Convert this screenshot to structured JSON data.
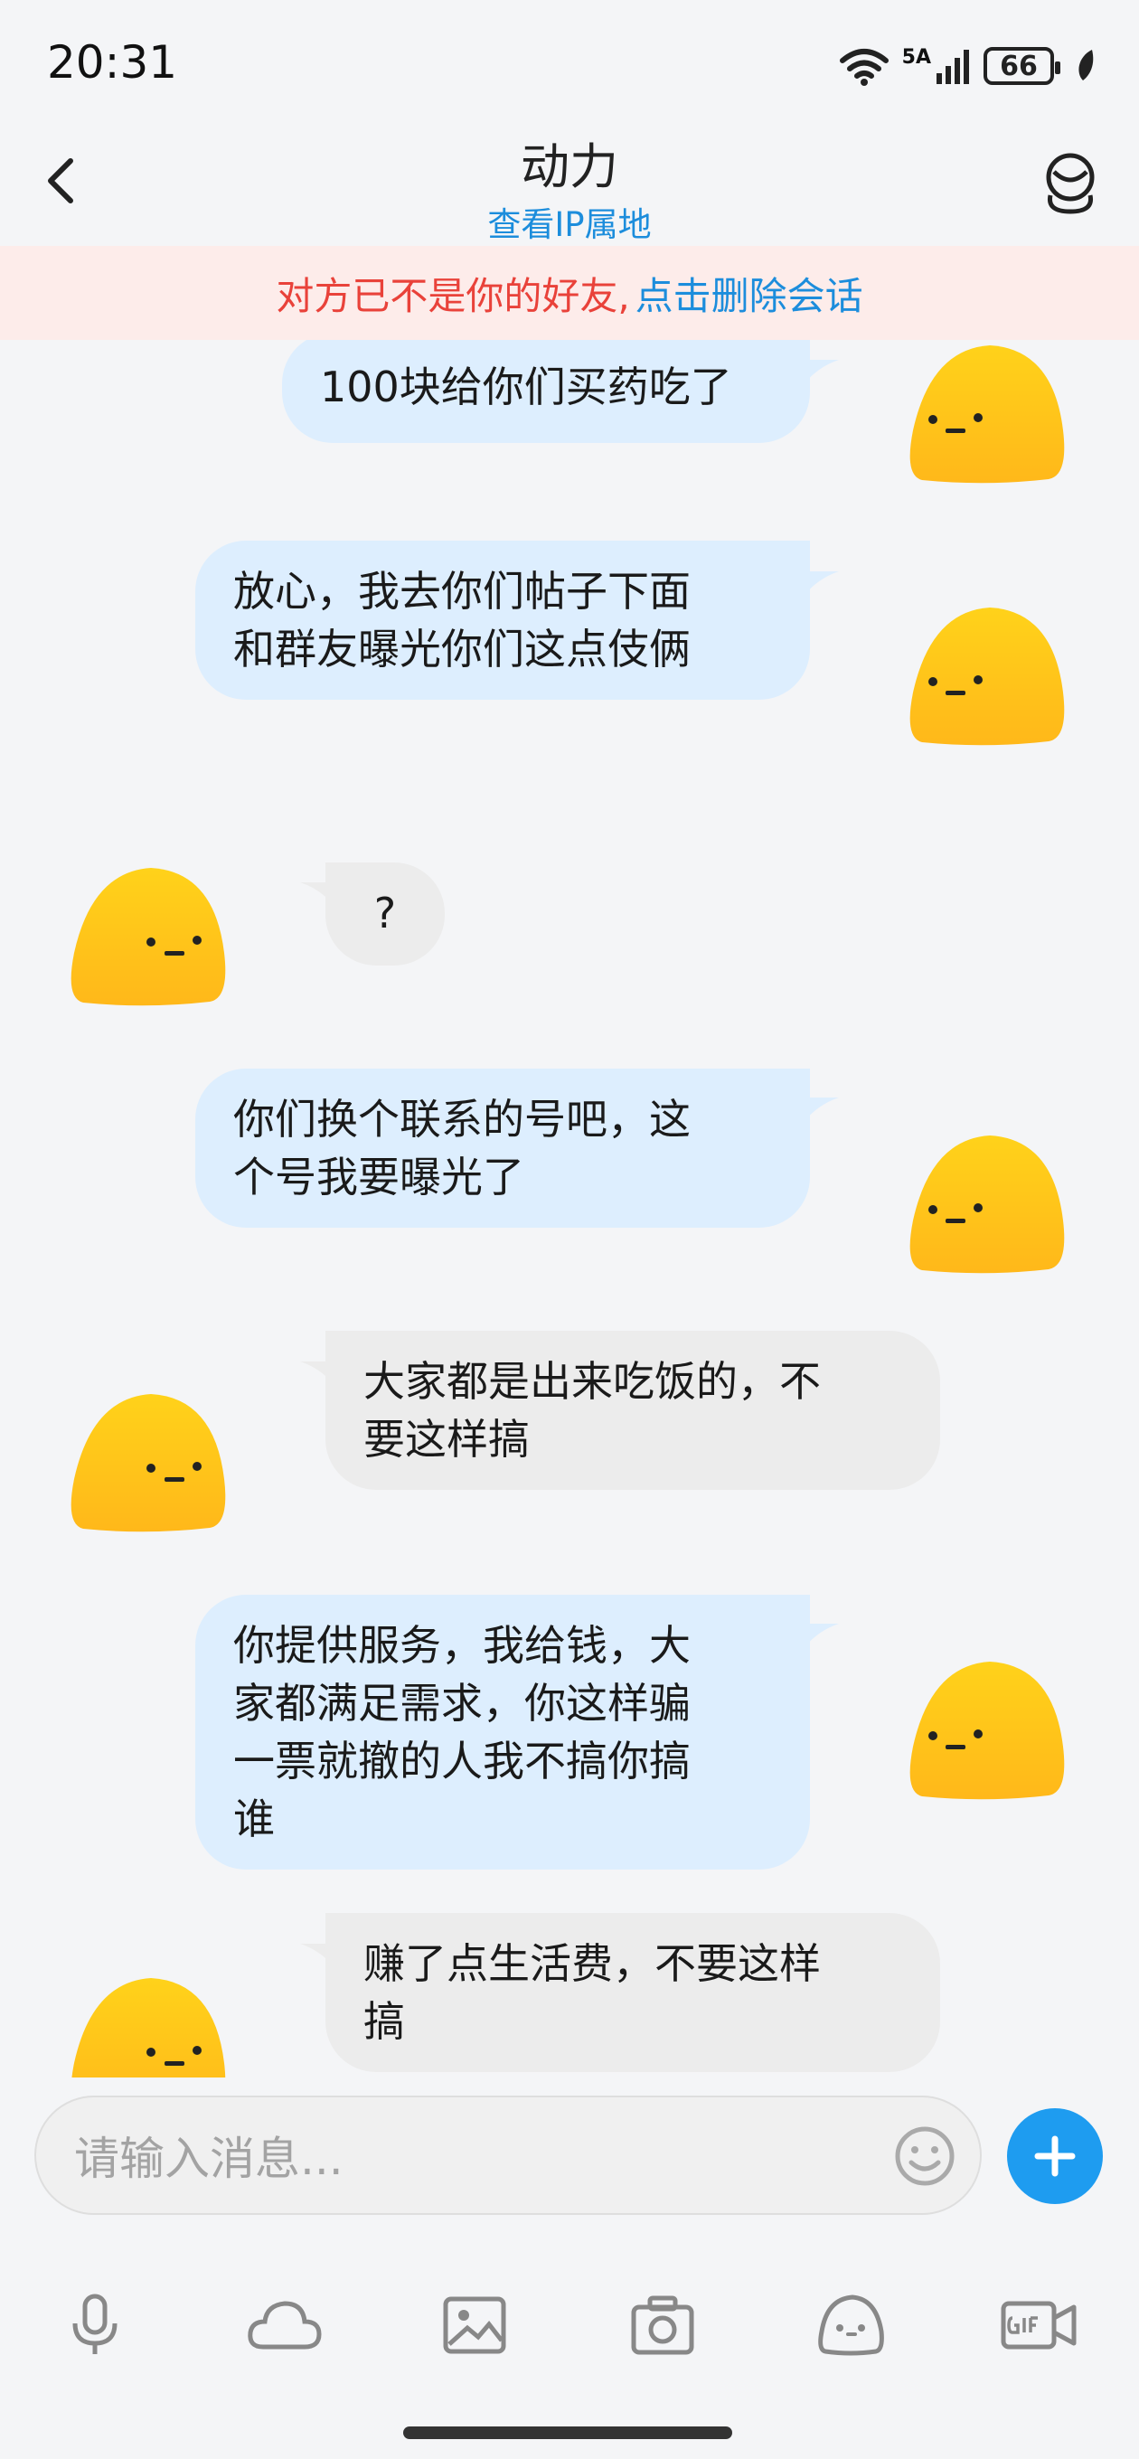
{
  "status_bar": {
    "time": "20:31",
    "network": "5A",
    "battery": "66"
  },
  "header": {
    "title": "动力",
    "subtitle_link": "查看IP属地"
  },
  "warning": {
    "text": "对方已不是你的好友,",
    "link": "点击删除会话"
  },
  "messages": [
    {
      "side": "out",
      "text": "100块给你们买药吃了"
    },
    {
      "side": "out",
      "text": "放心，我去你们帖子下面\n和群友曝光你们这点伎俩"
    },
    {
      "side": "in",
      "text": "?"
    },
    {
      "side": "out",
      "text": "你们换个联系的号吧，这\n个号我要曝光了"
    },
    {
      "side": "in",
      "text": "大家都是出来吃饭的，不\n要这样搞"
    },
    {
      "side": "out",
      "text": "你提供服务，我给钱，大\n家都满足需求，你这样骗\n一票就撤的人我不搞你搞\n谁"
    },
    {
      "side": "in",
      "text": "赚了点生活费，不要这样\n搞"
    }
  ],
  "input": {
    "placeholder": "请输入消息..."
  },
  "toolbar": {
    "items": [
      "microphone-icon",
      "cloud-icon",
      "image-icon",
      "camera-icon",
      "sticker-icon",
      "gif-icon"
    ]
  },
  "colors": {
    "out_bubble": "#ddeefe",
    "in_bubble": "#ececec",
    "link_blue": "#1c8ddc",
    "warning_red": "#e9423a",
    "accent": "#1e9cf0"
  }
}
